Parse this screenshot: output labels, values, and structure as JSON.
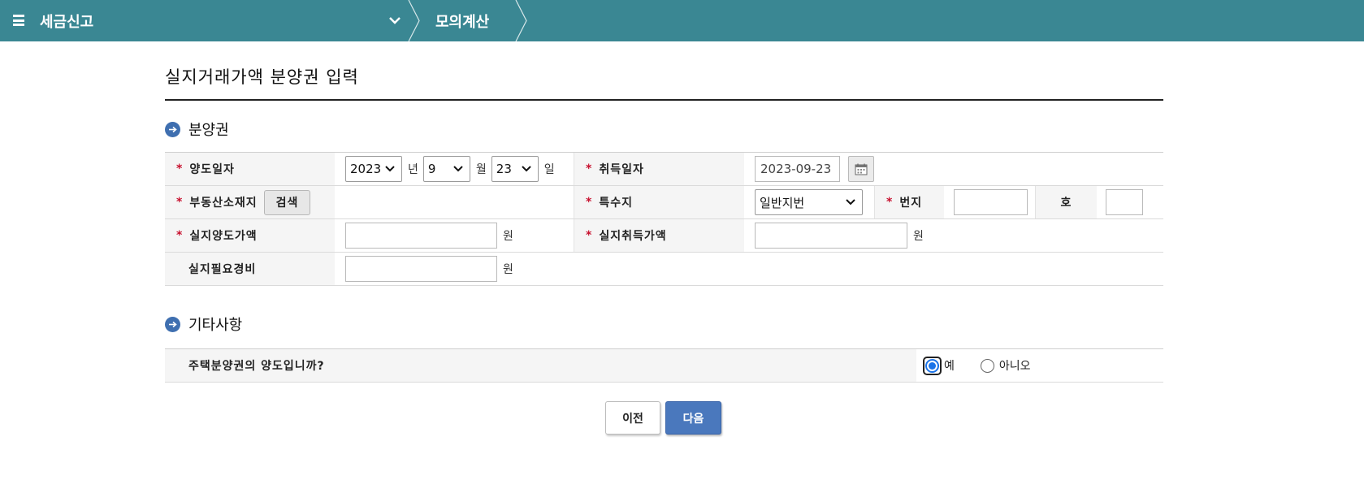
{
  "nav": {
    "menu_title": "세금신고",
    "current": "모의계산"
  },
  "page": {
    "title": "실지거래가액 분양권 입력"
  },
  "section1": {
    "title": "분양권",
    "transfer_date": {
      "label": "양도일자",
      "year": "2023",
      "year_unit": "년",
      "month": "9",
      "month_unit": "월",
      "day": "23",
      "day_unit": "일"
    },
    "acquire_date": {
      "label": "취득일자",
      "value": "2023-09-23"
    },
    "location": {
      "label": "부동산소재지",
      "search_button": "검색"
    },
    "special_lot": {
      "label": "특수지",
      "selected": "일반지번"
    },
    "lot_number": {
      "label": "번지",
      "value": ""
    },
    "ho": {
      "label": "호",
      "value": ""
    },
    "transfer_price": {
      "label": "실지양도가액",
      "value": "",
      "unit": "원"
    },
    "acquire_price": {
      "label": "실지취득가액",
      "value": "",
      "unit": "원"
    },
    "expenses": {
      "label": "실지필요경비",
      "value": "",
      "unit": "원"
    }
  },
  "section2": {
    "title": "기타사항",
    "question": "주택분양권의 양도입니까?",
    "options": [
      "예",
      "아니오"
    ],
    "selected": "예"
  },
  "buttons": {
    "prev": "이전",
    "next": "다음"
  },
  "colors": {
    "topbar": "#3a8793",
    "required_mark": "#c8102e",
    "next_button": "#4a78bd"
  }
}
